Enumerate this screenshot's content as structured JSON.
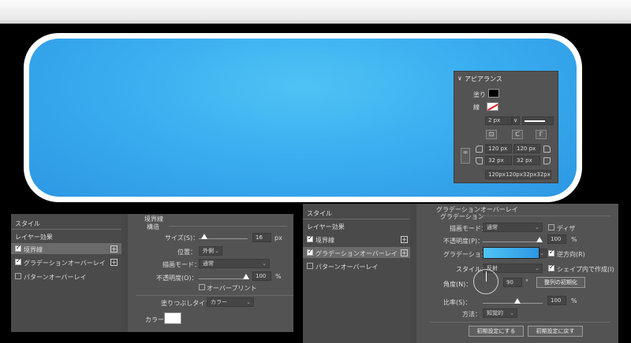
{
  "appearance": {
    "title": "アピアランス",
    "fill_label": "塗り",
    "stroke_label": "線",
    "stroke_width": "2 px",
    "width1": "120 px",
    "width2": "120 px",
    "height1": "32 px",
    "height2": "32 px",
    "summary": "120px120px32px32px",
    "chevron": "∨"
  },
  "left_dialog": {
    "styles_label": "スタイル",
    "layer_effects_label": "レイヤー効果",
    "items": [
      {
        "label": "境界線",
        "checked": true,
        "plus": "+"
      },
      {
        "label": "グラデーションオーバーレイ",
        "checked": true,
        "plus": "+"
      },
      {
        "label": "パターンオーバーレイ",
        "checked": false,
        "plus": ""
      }
    ],
    "section_title": "境界線",
    "subsection": "構造",
    "size_label": "サイズ(S)：",
    "size_value": "16",
    "size_unit": "px",
    "position_label": "位置：",
    "position_value": "外側",
    "blend_label": "描画モード：",
    "blend_value": "通常",
    "opacity_label": "不透明度(O)：",
    "opacity_value": "100",
    "opacity_unit": "%",
    "overprint_label": "オーバープリント",
    "fill_type_label": "塗りつぶしタイプ：",
    "fill_type_value": "カラー",
    "color_label": "カラー："
  },
  "right_dialog": {
    "styles_label": "スタイル",
    "layer_effects_label": "レイヤー効果",
    "items": [
      {
        "label": "境界線",
        "checked": true,
        "plus": "+"
      },
      {
        "label": "グラデーションオーバーレイ",
        "checked": true,
        "plus": "+"
      },
      {
        "label": "パターンオーバーレイ",
        "checked": false,
        "plus": ""
      }
    ],
    "section_title": "グラデーションオーバーレイ",
    "subsection": "グラデーション",
    "blend_label": "描画モード：",
    "blend_value": "通常",
    "dither_label": "ディザ",
    "opacity_label": "不透明度(P)：",
    "opacity_value": "100",
    "opacity_unit": "%",
    "gradient_label": "グラデーション：",
    "reverse_label": "逆方向(R)",
    "style_label": "スタイル：",
    "style_value": "反射",
    "align_label": "シェイプ内で作成(I)",
    "angle_label": "角度(N)：",
    "angle_value": "90",
    "angle_unit": "°",
    "reset_align_btn": "整列の初期化",
    "scale_label": "比率(S)：",
    "scale_value": "100",
    "scale_unit": "%",
    "method_label": "方法：",
    "method_value": "知覚的",
    "make_default_btn": "初期設定にする",
    "reset_default_btn": "初期設定に戻す"
  },
  "colors": {
    "gradient_start": "#4fc3f4",
    "gradient_end": "#2d97e3",
    "panel": "#535353"
  }
}
